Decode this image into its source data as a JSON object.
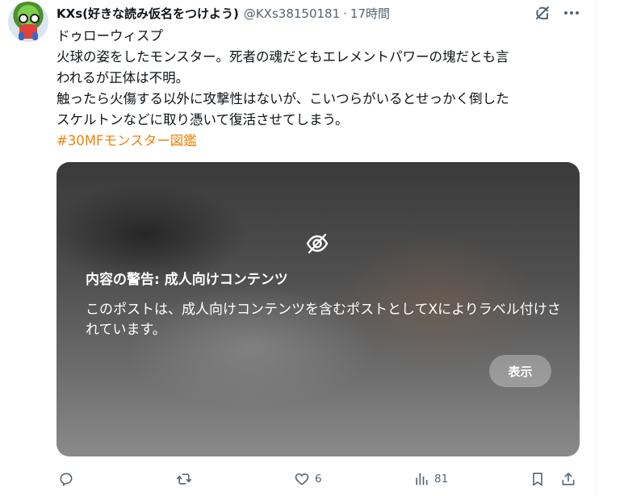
{
  "post": {
    "author_name": "KXs(好きな読み仮名をつけよう)",
    "author_handle": "@KXs38150181",
    "separator": "·",
    "timestamp": "17時間",
    "text_lines": [
      "ドゥローウィスプ",
      "火球の姿をしたモンスター。死者の魂だともエレメントパワーの塊だとも言",
      "われるが正体は不明。",
      "触ったら火傷する以外に攻撃性はないが、こいつらがいるとせっかく倒した",
      "スケルトンなどに取り憑いて復活させてしまう。"
    ],
    "hashtag": "#30MFモンスター図鑑"
  },
  "media_warning": {
    "title": "内容の警告: 成人向けコンテンツ",
    "body": "このポストは、成人向けコンテンツを含むポストとしてXによりラベル付けされています。",
    "show_button": "表示"
  },
  "actions": {
    "reply_count": "",
    "repost_count": "",
    "like_count": "6",
    "views_count": "81"
  },
  "icons": {
    "header": [
      "grok-icon",
      "more-icon"
    ],
    "media": "eye-off-icon",
    "actions": [
      "reply-icon",
      "repost-icon",
      "like-icon",
      "views-icon",
      "bookmark-icon",
      "share-icon"
    ]
  },
  "colors": {
    "hashtag": "#f0820a",
    "secondary_text": "#536471",
    "primary_text": "#0f1419"
  }
}
